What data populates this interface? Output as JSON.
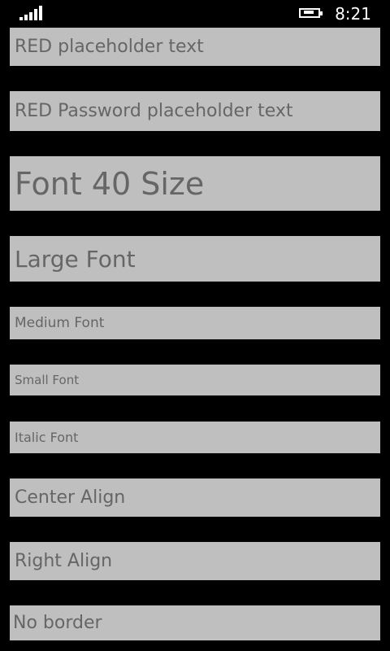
{
  "status_bar": {
    "time": "8:21",
    "icons": [
      "signal-strength-icon",
      "battery-charging-icon"
    ]
  },
  "fields": [
    {
      "placeholder": "RED placeholder text"
    },
    {
      "placeholder": "RED Password placeholder text"
    },
    {
      "placeholder": "Font 40 Size"
    },
    {
      "placeholder": "Large Font"
    },
    {
      "placeholder": "Medium Font"
    },
    {
      "placeholder": "Small Font"
    },
    {
      "placeholder": "Italic Font"
    },
    {
      "placeholder": "Center Align"
    },
    {
      "placeholder": "Right Align"
    },
    {
      "placeholder": "No border"
    }
  ],
  "colors": {
    "background": "#000000",
    "field_background": "#bfbfbf",
    "placeholder_text": "#666666",
    "status_text": "#ffffff"
  }
}
